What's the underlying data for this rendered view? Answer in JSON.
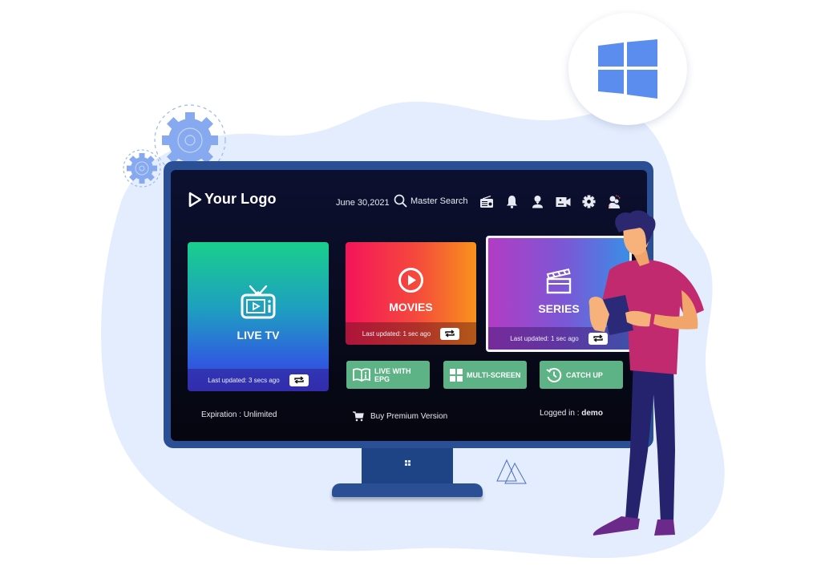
{
  "badge": {
    "icon": "windows-logo-icon",
    "color": "#5b8def"
  },
  "app": {
    "logo_text": "Your Logo",
    "date": "June 30,2021",
    "search_label": "Master Search",
    "header_icons": [
      "radio-icon",
      "bell-icon",
      "user-icon",
      "record-camera-icon",
      "gear-icon",
      "switch-user-icon"
    ]
  },
  "tiles": {
    "live_tv": {
      "label": "LIVE TV",
      "updated": "Last updated: 3 secs ago",
      "icon": "tv-icon"
    },
    "movies": {
      "label": "MOVIES",
      "updated": "Last updated: 1 sec ago",
      "icon": "play-circle-icon"
    },
    "series": {
      "label": "SERIES",
      "updated": "Last updated: 1 sec ago",
      "icon": "clapperboard-icon"
    }
  },
  "sub_buttons": {
    "epg": {
      "line1": "LIVE WITH",
      "line2": "EPG",
      "icon": "book-info-icon"
    },
    "multiscreen": {
      "label": "MULTI-SCREEN",
      "icon": "grid-icon"
    },
    "catchup": {
      "label": "CATCH UP",
      "icon": "history-icon"
    }
  },
  "footer": {
    "expiration": "Expiration : Unlimited",
    "buy": "Buy Premium Version",
    "logged_label": "Logged in : ",
    "logged_user": "demo"
  },
  "colors": {
    "accent_green": "#5db385",
    "monitor_blue": "#2a4f95",
    "blob": "#e4edfd"
  }
}
